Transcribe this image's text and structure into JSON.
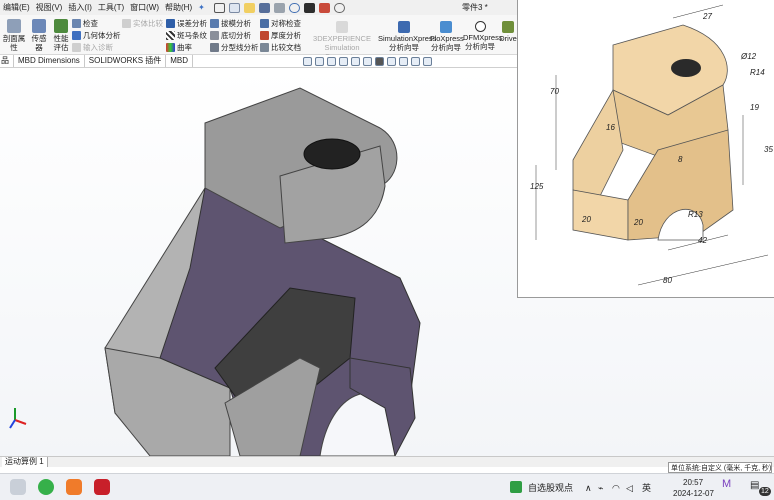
{
  "menu": {
    "items": [
      "编辑(E)",
      "视图(V)",
      "插入(I)",
      "工具(T)",
      "窗口(W)",
      "帮助(H)"
    ],
    "doc_title": "零件3 *"
  },
  "ribbon": {
    "big_buttons": [
      {
        "label_line1": "剖面属",
        "label_line2": "性"
      },
      {
        "label_line1": "传感器",
        "label_line2": ""
      },
      {
        "label_line1": "性能",
        "label_line2": "评估"
      }
    ],
    "col1": [
      "检查",
      "几何体分析",
      "输入诊断"
    ],
    "col1_extra": "实体比较",
    "col2": [
      "误差分析",
      "斑马条纹",
      "曲率"
    ],
    "col3": [
      "拔模分析",
      "底切分析",
      "分型线分析"
    ],
    "col4": [
      "对称检查",
      "厚度分析",
      "比较文档"
    ],
    "sim_connector": {
      "line1": "3DEXPERIENCE",
      "line2": "Simulation Connector"
    },
    "xpress": [
      {
        "line1": "SimulationXpress",
        "line2": "分析向导"
      },
      {
        "line1": "FloXpress",
        "line2": "分析向导"
      },
      {
        "line1": "DFMXpress",
        "line2": "分析向导"
      },
      {
        "line1": "Drive",
        "line2": ""
      }
    ]
  },
  "tabs": [
    "品",
    "MBD Dimensions",
    "SOLIDWORKS 插件",
    "MBD"
  ],
  "drawing": {
    "dims": [
      "27",
      "Ø12",
      "R14",
      "70",
      "16",
      "19",
      "35",
      "8",
      "125",
      "20",
      "R13",
      "20",
      "42",
      "80"
    ]
  },
  "status": {
    "tab_label": "运动算例 1",
    "units": "单位系统:自定义 (毫米, 千克, 秒)"
  },
  "taskbar": {
    "stock_text": "自选股观点",
    "lang": "英",
    "time": "20:57",
    "date": "2024-12-07",
    "badge": "12"
  },
  "colors": {
    "part_face_light": "#b9b9b9",
    "part_face_dark": "#5e5470",
    "drawing_face": "#f2d6a8",
    "taskbar_bg": "#eef0f4"
  }
}
